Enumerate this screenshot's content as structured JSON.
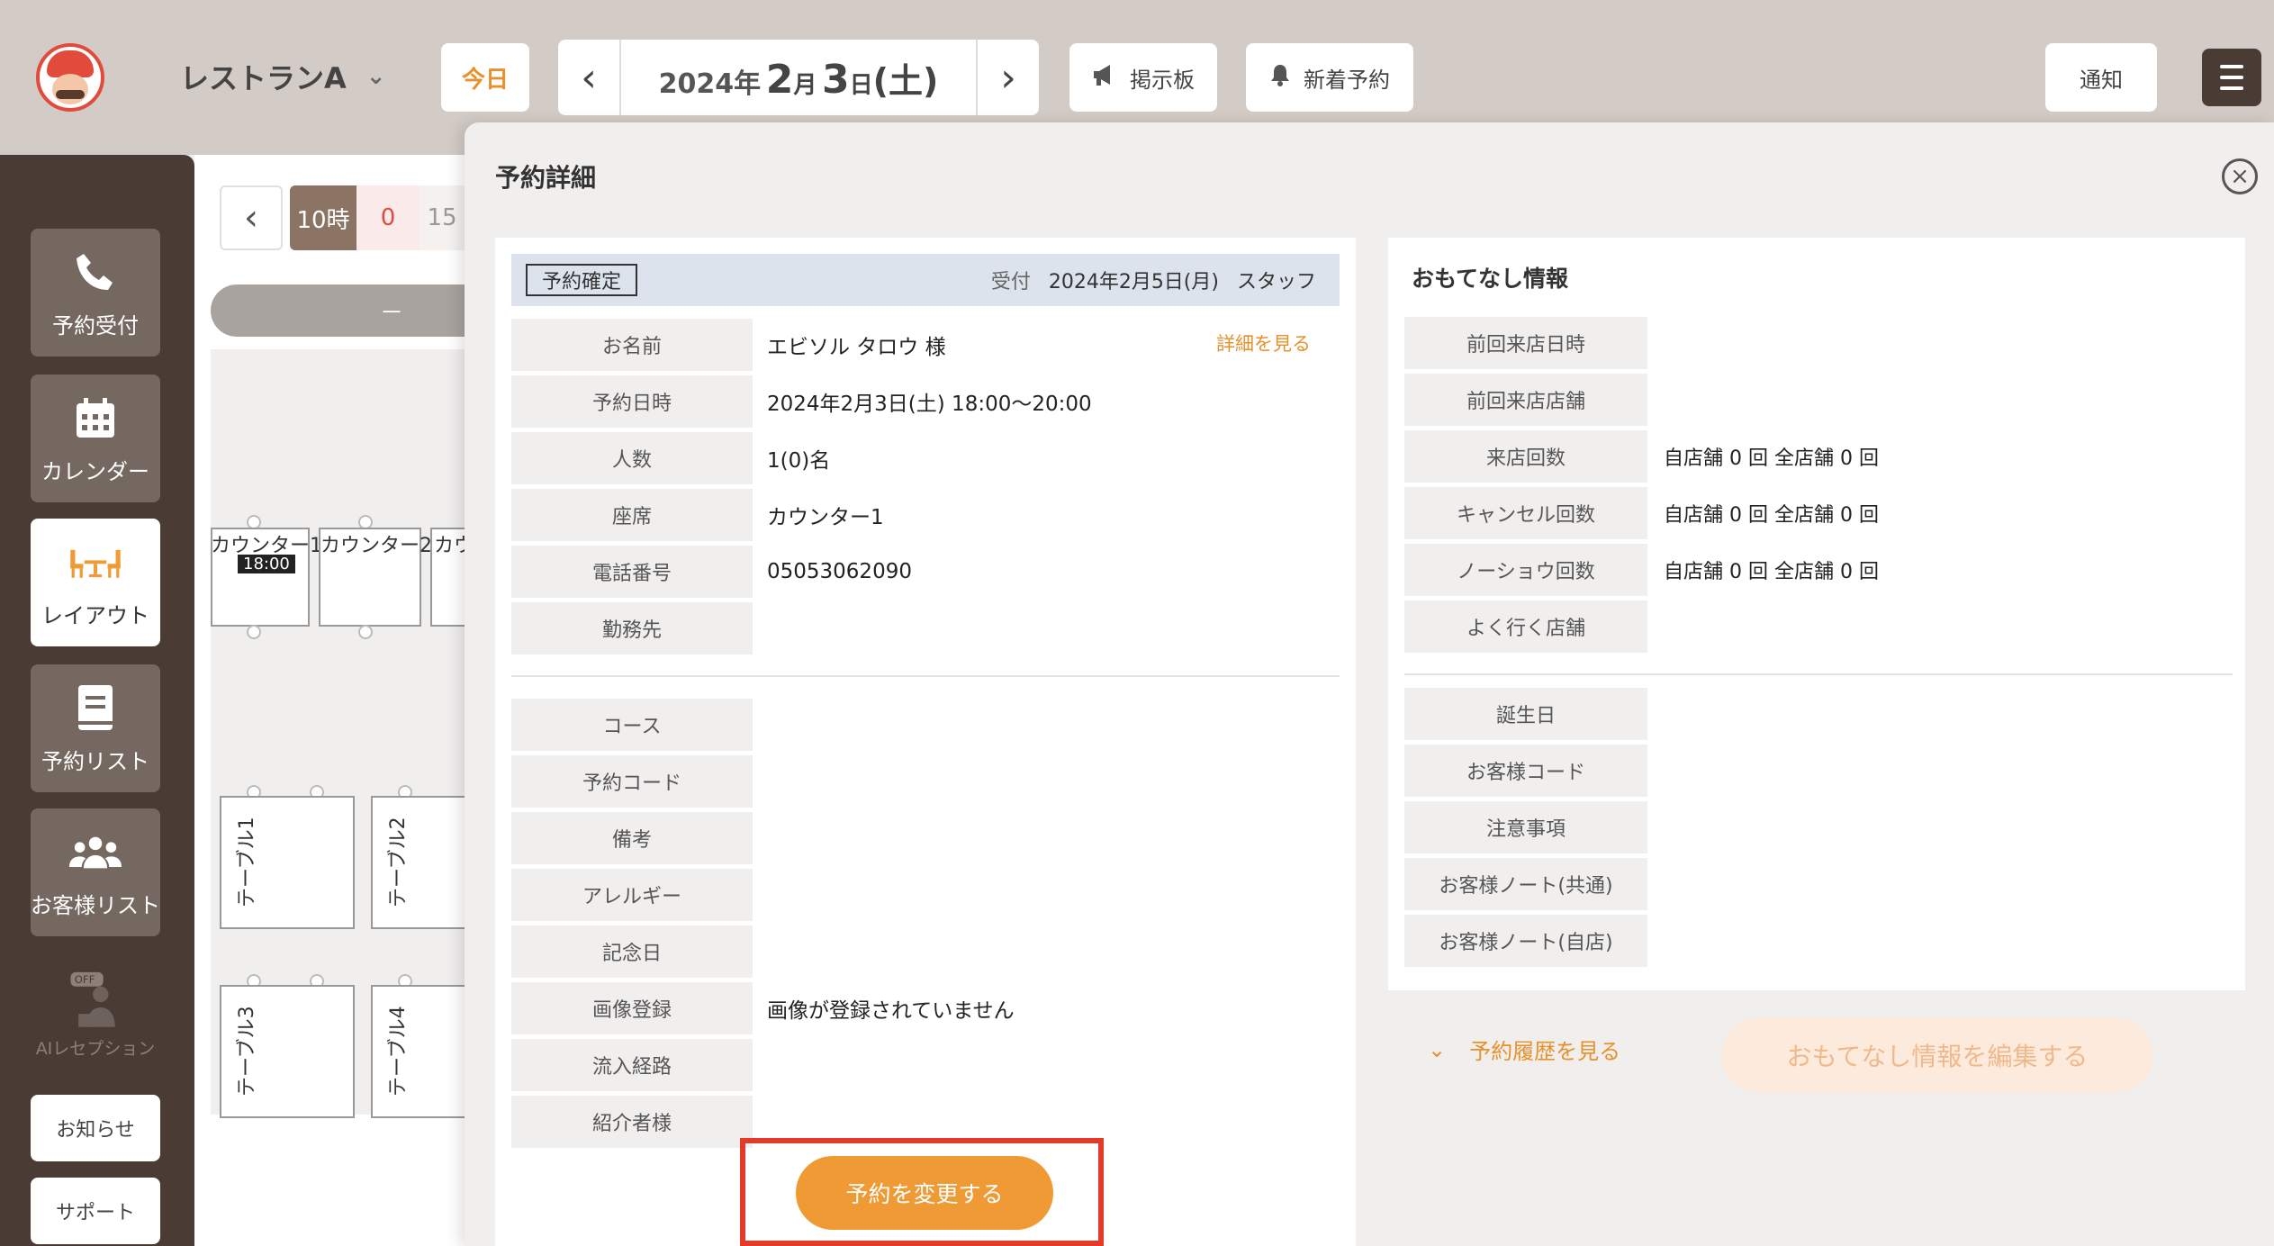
{
  "header": {
    "restaurant_name": "レストランA",
    "today_label": "今日",
    "date": {
      "year": "2024年",
      "month": "2",
      "month_suffix": "月",
      "day": "3",
      "day_suffix": "日",
      "weekday": "(土)"
    },
    "board_label": "掲示板",
    "new_reservation_label": "新着予約",
    "notice_label": "通知"
  },
  "sidebar": {
    "items": [
      {
        "label": "予約受付",
        "icon": "phone-icon"
      },
      {
        "label": "カレンダー",
        "icon": "calendar-icon"
      },
      {
        "label": "レイアウト",
        "icon": "table-chairs-icon",
        "active": true
      },
      {
        "label": "予約リスト",
        "icon": "book-icon"
      },
      {
        "label": "お客様リスト",
        "icon": "users-icon"
      },
      {
        "label": "AIレセプション",
        "icon": "receptionist-icon",
        "badge": "OFF",
        "disabled": true
      }
    ],
    "news_label": "お知らせ",
    "support_label": "サポート"
  },
  "layout": {
    "hour_tab": "10時",
    "count_tab": "0",
    "next_tab": "15",
    "bar_label": "－",
    "seats": [
      {
        "name": "カウンター1",
        "time": "18:00"
      },
      {
        "name": "カウンター2"
      },
      {
        "name": "カウ"
      }
    ],
    "tables": [
      "テーブル1",
      "テーブル2",
      "テーブル3",
      "テーブル4"
    ]
  },
  "modal": {
    "title": "予約詳細",
    "status": "予約確定",
    "received_label": "受付",
    "received_date": "2024年2月5日(月)",
    "received_by": "スタッフ",
    "detail_link": "詳細を見る",
    "fields": [
      {
        "label": "お名前",
        "value": "エビソル タロウ 様"
      },
      {
        "label": "予約日時",
        "value": "2024年2月3日(土) 18:00〜20:00"
      },
      {
        "label": "人数",
        "value": "1(0)名"
      },
      {
        "label": "座席",
        "value": "カウンター1"
      },
      {
        "label": "電話番号",
        "value": "05053062090"
      },
      {
        "label": "勤務先",
        "value": ""
      }
    ],
    "fields2": [
      {
        "label": "コース",
        "value": ""
      },
      {
        "label": "予約コード",
        "value": ""
      },
      {
        "label": "備考",
        "value": ""
      },
      {
        "label": "アレルギー",
        "value": ""
      },
      {
        "label": "記念日",
        "value": ""
      },
      {
        "label": "画像登録",
        "value": "画像が登録されていません"
      },
      {
        "label": "流入経路",
        "value": ""
      },
      {
        "label": "紹介者様",
        "value": ""
      }
    ],
    "hospitality": {
      "title": "おもてなし情報",
      "fields": [
        {
          "label": "前回来店日時",
          "value": ""
        },
        {
          "label": "前回来店店舗",
          "value": ""
        },
        {
          "label": "来店回数",
          "value": "自店舗 0 回 全店舗 0 回"
        },
        {
          "label": "キャンセル回数",
          "value": "自店舗 0 回 全店舗 0 回"
        },
        {
          "label": "ノーショウ回数",
          "value": "自店舗 0 回 全店舗 0 回"
        },
        {
          "label": "よく行く店舗",
          "value": ""
        }
      ],
      "fields2": [
        {
          "label": "誕生日",
          "value": ""
        },
        {
          "label": "お客様コード",
          "value": ""
        },
        {
          "label": "注意事項",
          "value": ""
        },
        {
          "label": "お客様ノート(共通)",
          "value": ""
        },
        {
          "label": "お客様ノート(自店)",
          "value": ""
        }
      ]
    },
    "history_link": "予約履歴を見る",
    "edit_hospitality_label": "おもてなし情報を編集する",
    "change_button_label": "予約を変更する"
  },
  "colors": {
    "accent": "#ef9a35",
    "sidebar": "#4a3c34",
    "topbar": "#d3cbc5",
    "highlight": "#e23b2a"
  }
}
